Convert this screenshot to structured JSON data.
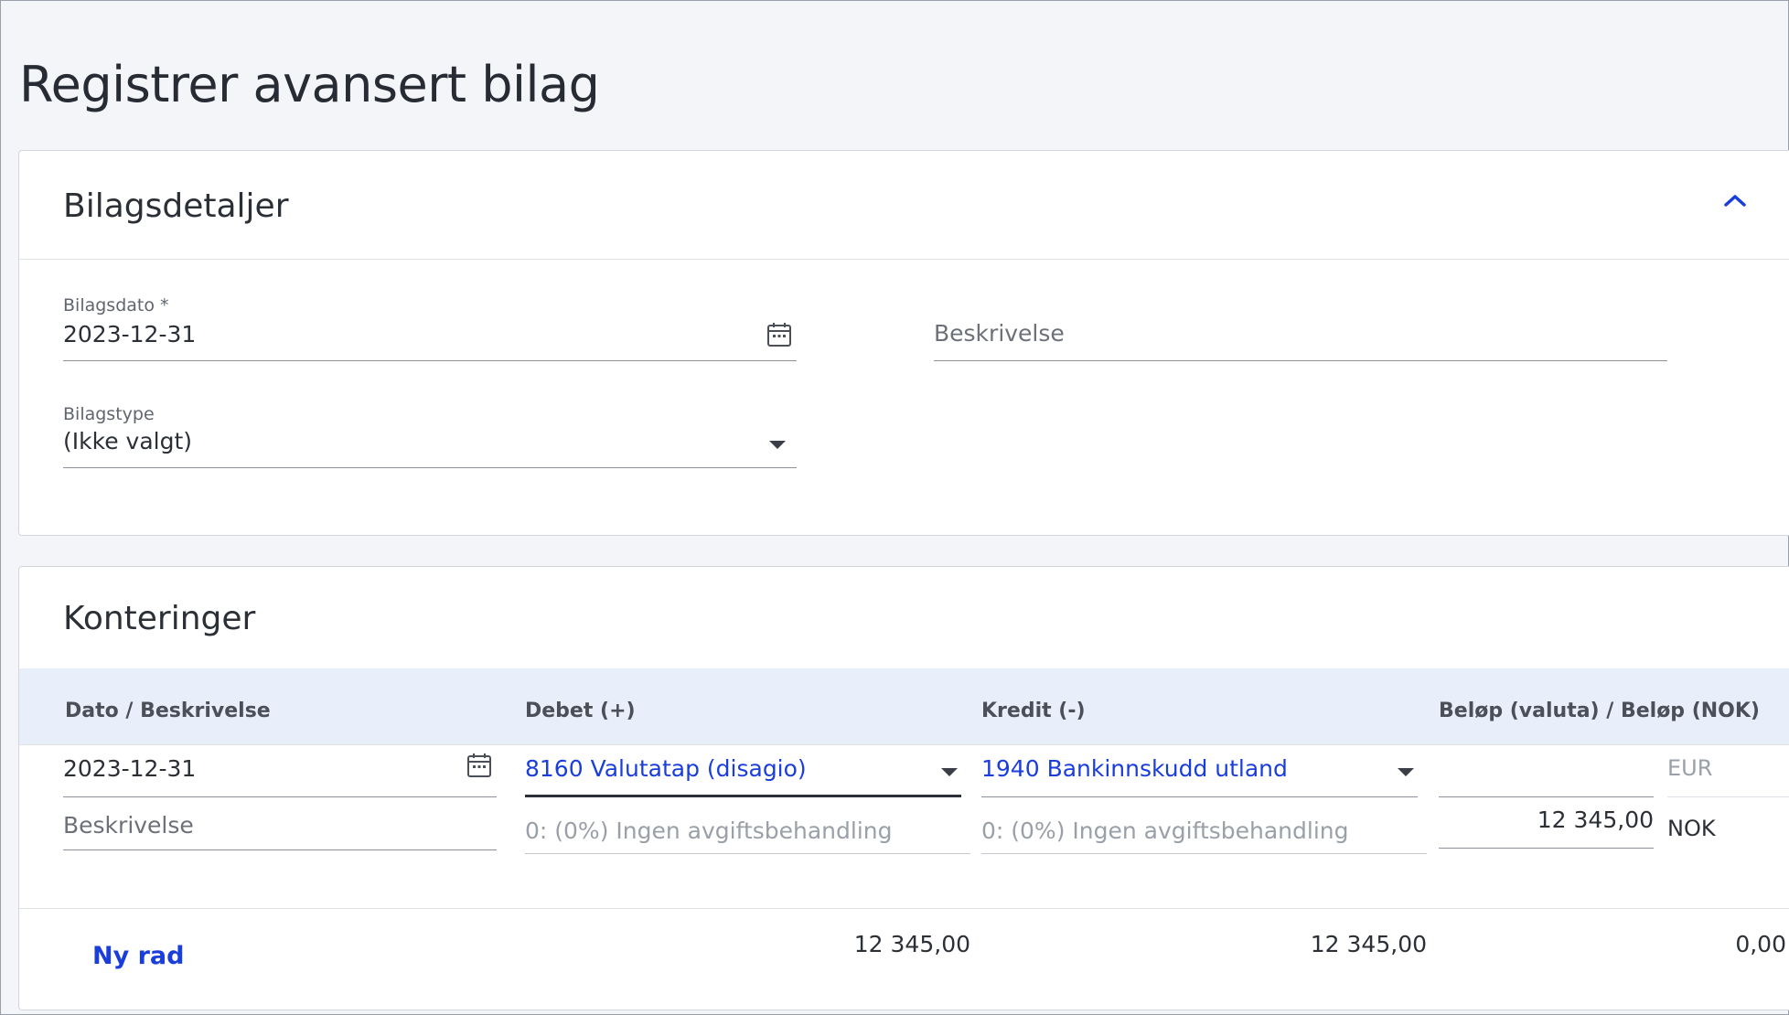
{
  "page": {
    "title": "Registrer avansert bilag"
  },
  "details": {
    "title": "Bilagsdetaljer",
    "date_label": "Bilagsdato *",
    "date_value": "2023-12-31",
    "description_placeholder": "Beskrivelse",
    "type_label": "Bilagstype",
    "type_value": "(Ikke valgt)"
  },
  "postings": {
    "title": "Konteringer",
    "columns": {
      "date_desc": "Dato / Beskrivelse",
      "debit": "Debet (+)",
      "credit": "Kredit (-)",
      "amount": "Beløp (valuta) / Beløp (NOK)"
    },
    "row": {
      "date": "2023-12-31",
      "description_placeholder": "Beskrivelse",
      "debit_account": "8160 Valutatap (disagio)",
      "debit_vat": "0: (0%) Ingen avgiftsbehandling",
      "credit_account": "1940 Bankinnskudd utland",
      "credit_vat": "0: (0%) Ingen avgiftsbehandling",
      "currency_amount": "",
      "currency_code": "EUR",
      "nok_amount": "12 345,00",
      "nok_code": "NOK"
    },
    "totals": {
      "debit": "12 345,00",
      "credit": "12 345,00",
      "balance": "0,00"
    },
    "new_row_label": "Ny rad"
  },
  "colors": {
    "accent": "#1a3edb",
    "header_bg": "#e8effb",
    "page_bg": "#f4f5f9"
  }
}
